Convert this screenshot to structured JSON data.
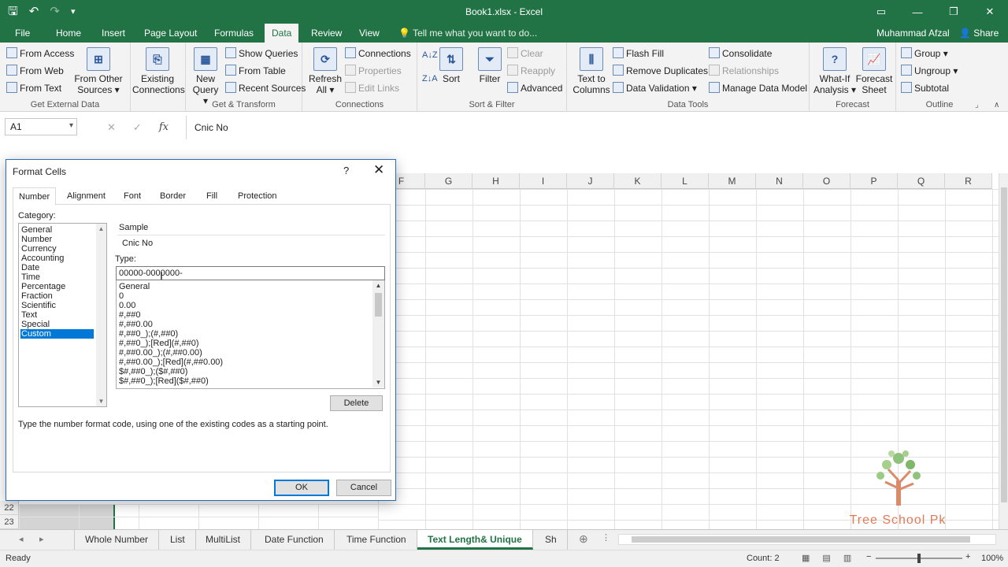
{
  "window": {
    "title": "Book1.xlsx - Excel",
    "accent": "#217346"
  },
  "menu": {
    "tabs": [
      "File",
      "Home",
      "Insert",
      "Page Layout",
      "Formulas",
      "Data",
      "Review",
      "View"
    ],
    "active_tab": "Data",
    "tell_me": "Tell me what you want to do...",
    "user": "Muhammad Afzal",
    "share": "Share"
  },
  "ribbon": {
    "get_external": {
      "label": "Get External Data",
      "from_access": "From Access",
      "from_web": "From Web",
      "from_text": "From Text",
      "from_other_1": "From Other",
      "from_other_2": "Sources",
      "existing_1": "Existing",
      "existing_2": "Connections"
    },
    "get_transform": {
      "label": "Get & Transform",
      "new_query_1": "New",
      "new_query_2": "Query",
      "show_queries": "Show Queries",
      "from_table": "From Table",
      "recent_sources": "Recent Sources"
    },
    "connections": {
      "label": "Connections",
      "refresh_1": "Refresh",
      "refresh_2": "All",
      "connections": "Connections",
      "properties": "Properties",
      "edit_links": "Edit Links"
    },
    "sort_filter": {
      "label": "Sort & Filter",
      "sort": "Sort",
      "filter": "Filter",
      "clear": "Clear",
      "reapply": "Reapply",
      "advanced": "Advanced"
    },
    "data_tools": {
      "label": "Data Tools",
      "text_to_1": "Text to",
      "text_to_2": "Columns",
      "flash_fill": "Flash Fill",
      "remove_duplicates": "Remove Duplicates",
      "data_validation": "Data Validation",
      "consolidate": "Consolidate",
      "relationships": "Relationships",
      "manage_data_model": "Manage Data Model"
    },
    "forecast": {
      "label": "Forecast",
      "what_if_1": "What-If",
      "what_if_2": "Analysis",
      "forecast_1": "Forecast",
      "forecast_2": "Sheet"
    },
    "outline": {
      "label": "Outline",
      "group": "Group",
      "ungroup": "Ungroup",
      "subtotal": "Subtotal"
    }
  },
  "formula_bar": {
    "name_box": "A1",
    "fx": "fx",
    "content": "Cnic No"
  },
  "sheet": {
    "columns": [
      "F",
      "G",
      "H",
      "I",
      "J",
      "K",
      "L",
      "M",
      "N",
      "O",
      "P",
      "Q",
      "R"
    ],
    "rows": [
      "22",
      "23"
    ]
  },
  "dialog": {
    "title": "Format Cells",
    "help": "?",
    "tabs": [
      "Number",
      "Alignment",
      "Font",
      "Border",
      "Fill",
      "Protection"
    ],
    "active_tab": "Number",
    "category_label": "Category:",
    "categories": [
      "General",
      "Number",
      "Currency",
      "Accounting",
      "Date",
      "Time",
      "Percentage",
      "Fraction",
      "Scientific",
      "Text",
      "Special",
      "Custom"
    ],
    "selected_category": "Custom",
    "sample_label": "Sample",
    "sample_value": "Cnic No",
    "type_label": "Type:",
    "type_value": "00000-0000000-",
    "formats": [
      "General",
      "0",
      "0.00",
      "#,##0",
      "#,##0.00",
      "#,##0_);(#,##0)",
      "#,##0_);[Red](#,##0)",
      "#,##0.00_);(#,##0.00)",
      "#,##0.00_);[Red](#,##0.00)",
      "$#,##0_);($#,##0)",
      "$#,##0_);[Red]($#,##0)"
    ],
    "delete_label": "Delete",
    "hint": "Type the number format code, using one of the existing codes as a starting point.",
    "ok_label": "OK",
    "cancel_label": "Cancel"
  },
  "sheet_tabs": {
    "tabs": [
      "Whole Number",
      "List",
      "MultiList",
      "Date Function",
      "Time Function",
      "Text Length& Unique",
      "Sh"
    ],
    "active_tab": "Text Length& Unique"
  },
  "status": {
    "ready": "Ready",
    "count": "Count: 2",
    "zoom": "100%"
  },
  "watermark": {
    "text": "Tree School Pk"
  }
}
